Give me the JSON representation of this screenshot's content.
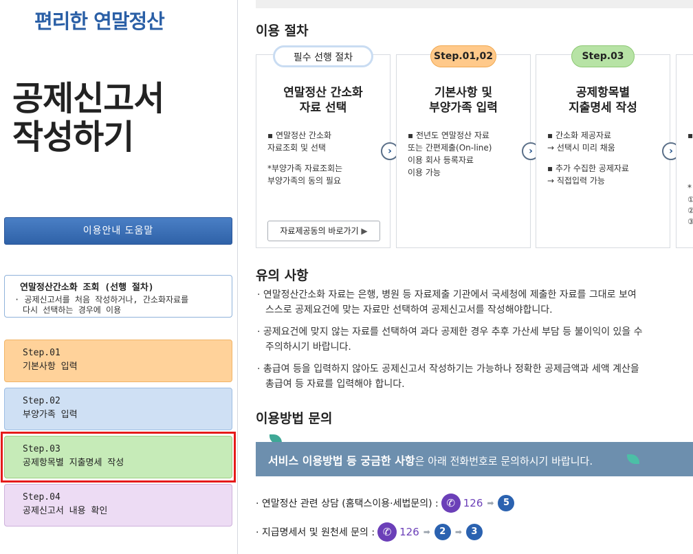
{
  "sidebar": {
    "brand": "편리한 연말정산",
    "title_line1": "공제신고서",
    "title_line2": "작성하기",
    "help_button": "이용안내 도움말",
    "pre_step": {
      "title": "연말정산간소화 조회 (선행 절차)",
      "desc_line1": "· 공제신고서를 처음 작성하거나, 간소화자료를",
      "desc_line2": "다시 선택하는 경우에 이용"
    },
    "steps": [
      {
        "label": "Step.01",
        "desc": "기본사항 입력"
      },
      {
        "label": "Step.02",
        "desc": "부양가족 입력"
      },
      {
        "label": "Step.03",
        "desc": "공제항목별 지출명세 작성"
      },
      {
        "label": "Step.04",
        "desc": "공제신고서 내용 확인"
      }
    ]
  },
  "main": {
    "procedure_heading": "이용 절차",
    "cards": [
      {
        "pill": "필수 선행 절차",
        "title_line1": "연말정산 간소화",
        "title_line2": "자료 선택",
        "body": [
          "▪ 연말정산 간소화\n   자료조회 및 선택",
          "*부양가족 자료조회는\n부양가족의 동의 필요"
        ],
        "link": "자료제공동의 바로가기"
      },
      {
        "pill": "Step.01,02",
        "title_line1": "기본사항 및",
        "title_line2": "부양가족 입력",
        "body": [
          "▪ 전년도 연말정산 자료\n   또는 간편제출(On-line)\n   이용 회사 등록자료\n   이용 가능"
        ]
      },
      {
        "pill": "Step.03",
        "title_line1": "공제항목별",
        "title_line2": "지출명세 작성",
        "body": [
          "▪ 간소화 제공자료\n  → 선택시 미리 채움",
          "▪ 추가 수집한 공제자료\n  → 직접입력 가능"
        ]
      }
    ],
    "card4_fragments": [
      "▪",
      "*",
      "①",
      "②",
      "③"
    ],
    "notes_heading": "유의 사항",
    "notes": [
      "· 연말정산간소화 자료는 은행, 병원 등 자료제출 기관에서 국세청에 제출한 자료를 그대로 보여",
      "스스로 공제요건에 맞는 자료만 선택하여 공제신고서를 작성해야합니다.",
      "· 공제요건에 맞지 않는 자료를 선택하여 과다 공제한 경우 추후 가산세 부담 등 불이익이 있을 수",
      "주의하시기 바랍니다.",
      "· 총급여 등을 입력하지 않아도 공제신고서 작성하기는 가능하나 정확한 공제금액과 세액 계산을",
      "총급여 등 자료를 입력해야 합니다."
    ],
    "inquiry_heading": "이용방법 문의",
    "banner_bold": "서비스 이용방법 등 궁금한 사항",
    "banner_rest": "은 아래 전화번호로 문의하시기 바랍니다.",
    "contacts": [
      {
        "label": "· 연말정산 관련 상담 (홈택스이용·세법문의) :",
        "number": "126",
        "steps": [
          "5"
        ]
      },
      {
        "label": "· 지급명세서 및 원천세 문의 :",
        "number": "126",
        "steps": [
          "2",
          "3"
        ]
      }
    ],
    "arrow_glyph": "›",
    "phone_glyph": "✆",
    "chevron_glyph": "➡"
  }
}
